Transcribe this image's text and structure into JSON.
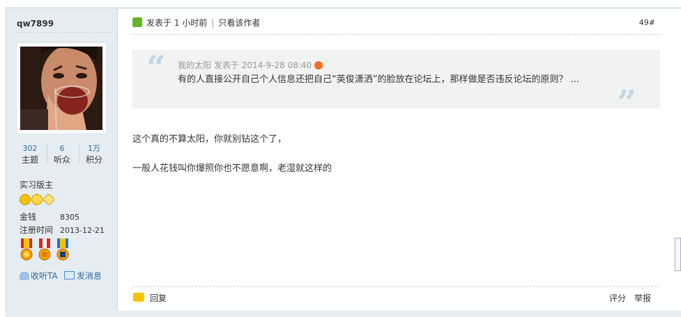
{
  "user": {
    "name": "qw7899",
    "stats": [
      {
        "value": "302",
        "label": "主题"
      },
      {
        "value": "6",
        "label": "听众"
      },
      {
        "value": "1万",
        "label": "积分"
      }
    ],
    "rank": "实习版主",
    "info": [
      {
        "key": "金钱",
        "value": "8305"
      },
      {
        "key": "注册时间",
        "value": "2013-12-21"
      }
    ],
    "links": {
      "follow": "收听TA",
      "message": "发消息"
    }
  },
  "post": {
    "posted_label": "发表于",
    "posted_time": "1 小时前",
    "only_author": "只看该作者",
    "floor": "49#",
    "quote": {
      "author": "我的太阳",
      "posted_label": "发表于",
      "time": "2014-9-28 08:40",
      "text": "有的人直接公开自己个人信息还把自己“英俊潇洒”的脸放在论坛上，那样做是否违反论坛的原则？ ..."
    },
    "body": [
      "这个真的不算太阳，你就别钻这个了，",
      "一般人花钱叫你爆照你也不愿意啊，老湿就这样的"
    ],
    "footer": {
      "reply": "回复",
      "rate": "评分",
      "report": "举报"
    }
  },
  "colors": {
    "sidebar_bg": "#e5edf2",
    "border": "#c2d5e3",
    "link": "#336699",
    "quote_bg": "#f1f2f2",
    "online_icon": "#68b22a"
  }
}
